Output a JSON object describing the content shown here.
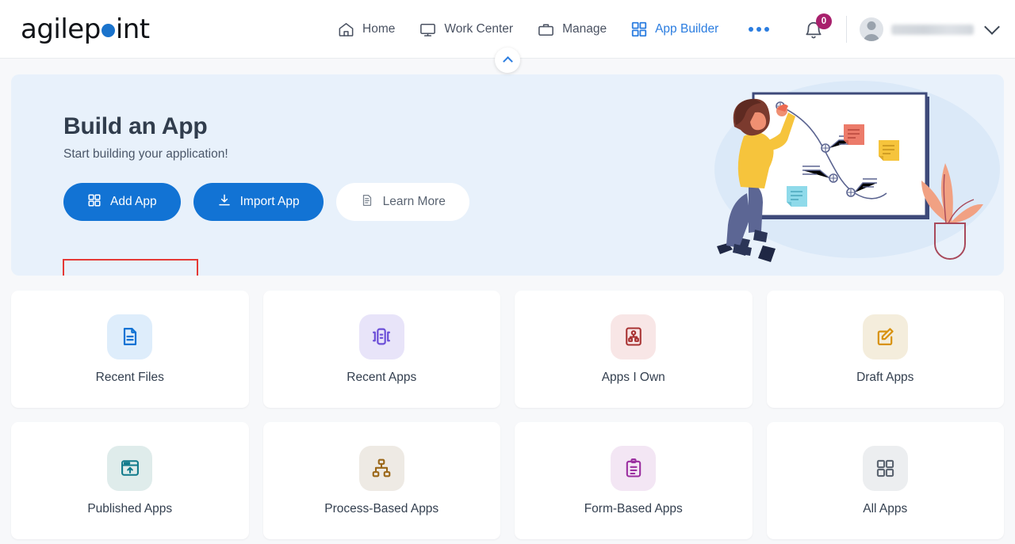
{
  "brand": {
    "logo_text_1": "agilep",
    "logo_text_2": "int",
    "logo_dot_color": "#1a73cc"
  },
  "header": {
    "nav": [
      {
        "label": "Home",
        "icon": "home-icon",
        "active": false
      },
      {
        "label": "Work Center",
        "icon": "monitor-icon",
        "active": false
      },
      {
        "label": "Manage",
        "icon": "briefcase-icon",
        "active": false
      },
      {
        "label": "App Builder",
        "icon": "grid-icon",
        "active": true
      }
    ],
    "overflow_icon": "more-horizontal-icon",
    "notifications": {
      "icon": "bell-icon",
      "count": "0",
      "badge_color": "#a8206c"
    },
    "user": {
      "avatar_icon": "avatar-icon",
      "name": "",
      "chevron_icon": "chevron-down-icon"
    },
    "collapse_icon": "chevron-up-icon",
    "accent_color": "#2b7de0"
  },
  "banner": {
    "title": "Build an App",
    "subtitle": "Start building your application!",
    "background_color": "#e8f1fb",
    "buttons": [
      {
        "label": "Add App",
        "icon": "grid-icon",
        "style": "primary",
        "highlighted": true
      },
      {
        "label": "Import App",
        "icon": "download-icon",
        "style": "primary",
        "highlighted": false
      },
      {
        "label": "Learn More",
        "icon": "document-icon",
        "style": "white",
        "highlighted": false
      }
    ],
    "illustration": "whiteboard-person-illustration",
    "annotation_color": "#e53935"
  },
  "cards": [
    {
      "label": "Recent Files",
      "icon": "file-document-icon",
      "icon_color": "#1273d4",
      "bg_color": "#deedfb"
    },
    {
      "label": "Recent Apps",
      "icon": "app-brackets-icon",
      "icon_color": "#6c4fd8",
      "bg_color": "#e8e4f9"
    },
    {
      "label": "Apps I Own",
      "icon": "owner-hierarchy-icon",
      "icon_color": "#a83232",
      "bg_color": "#f8e6e6"
    },
    {
      "label": "Draft Apps",
      "icon": "edit-pencil-icon",
      "icon_color": "#d8920f",
      "bg_color": "#f4eddc"
    },
    {
      "label": "Published Apps",
      "icon": "publish-window-icon",
      "icon_color": "#117a8b",
      "bg_color": "#dfeceb"
    },
    {
      "label": "Process-Based Apps",
      "icon": "org-chart-icon",
      "icon_color": "#9a6616",
      "bg_color": "#eeeae4"
    },
    {
      "label": "Form-Based Apps",
      "icon": "clipboard-icon",
      "icon_color": "#9b2fa0",
      "bg_color": "#f3e6f4"
    },
    {
      "label": "All Apps",
      "icon": "grid-squares-icon",
      "icon_color": "#5d6672",
      "bg_color": "#eceef0"
    }
  ]
}
